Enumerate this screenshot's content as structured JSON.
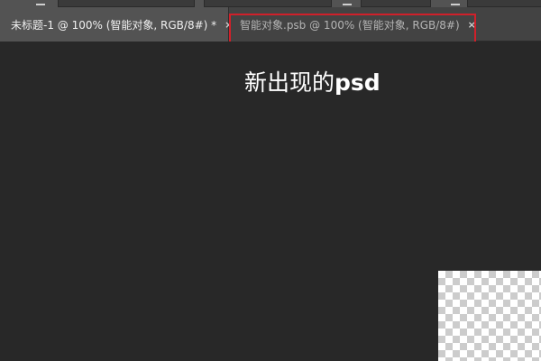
{
  "tabs": [
    {
      "label": "未标题-1 @ 100% (智能对象, RGB/8#) *",
      "close": "×",
      "active": true
    },
    {
      "label": "智能对象.psb @ 100% (智能对象, RGB/8#)",
      "close": "×",
      "active": false
    }
  ],
  "annotation": {
    "text_cn": "新出现的",
    "text_en": "psd",
    "highlight_color": "#d0202a"
  },
  "colors": {
    "canvas_bg": "#282828",
    "tab_bar_bg": "#434343",
    "active_tab_bg": "#535353"
  }
}
